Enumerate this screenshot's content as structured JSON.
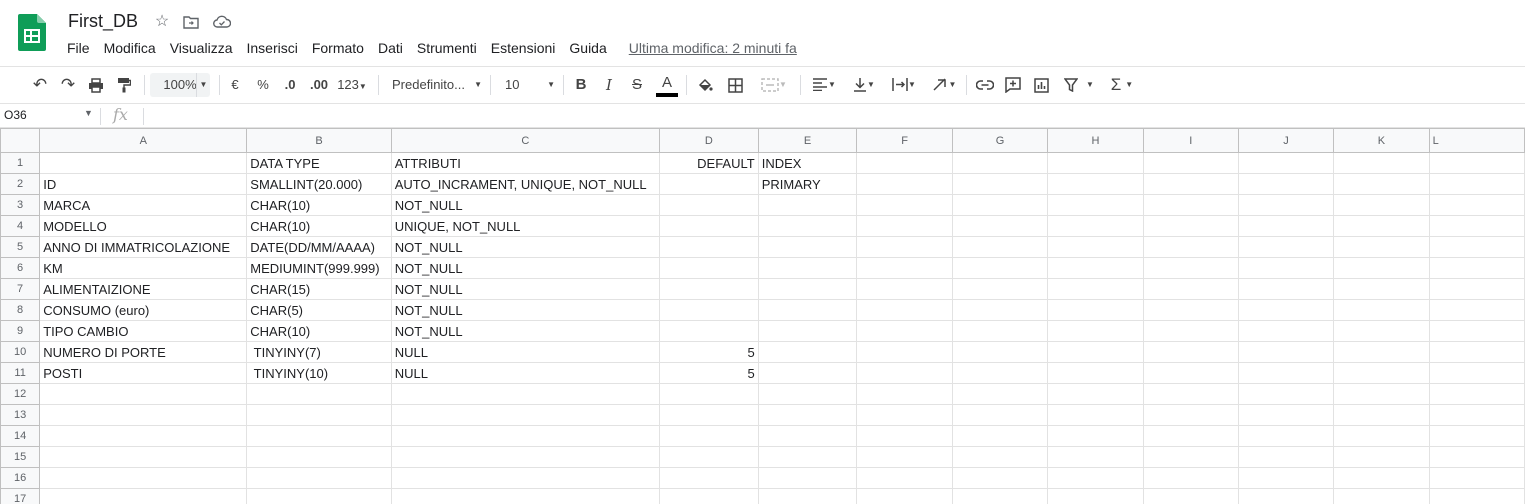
{
  "app": {
    "doc_title": "First_DB",
    "menu": [
      "File",
      "Modifica",
      "Visualizza",
      "Inserisci",
      "Formato",
      "Dati",
      "Strumenti",
      "Estensioni",
      "Guida"
    ],
    "last_edit": "Ultima modifica: 2 minuti fa",
    "brand_color": "#0f9d58"
  },
  "toolbar": {
    "zoom": "100%",
    "currency": "€",
    "percent": "%",
    "dec_decrease": ".0",
    "dec_increase": ".00",
    "number_format": "123",
    "font": "Predefinito...",
    "font_size": "10",
    "bold": "B",
    "italic": "I",
    "strike": "S",
    "text_color": "A"
  },
  "formula_bar": {
    "cell_ref": "O36",
    "fx": "fx",
    "value": ""
  },
  "sheet": {
    "columns": [
      "A",
      "B",
      "C",
      "D",
      "E",
      "F",
      "G",
      "H",
      "I",
      "J",
      "K",
      "L"
    ],
    "rows": [
      {
        "num": "1",
        "cells": [
          "",
          "DATA TYPE",
          "ATTRIBUTI",
          "DEFAULT",
          "INDEX"
        ]
      },
      {
        "num": "2",
        "cells": [
          "ID",
          "SMALLINT(20.000)",
          "AUTO_INCRAMENT, UNIQUE, NOT_NULL",
          "",
          "PRIMARY"
        ]
      },
      {
        "num": "3",
        "cells": [
          "MARCA",
          "CHAR(10)",
          "NOT_NULL",
          "",
          ""
        ]
      },
      {
        "num": "4",
        "cells": [
          "MODELLO",
          "CHAR(10)",
          "UNIQUE, NOT_NULL",
          "",
          ""
        ]
      },
      {
        "num": "5",
        "cells": [
          "ANNO DI IMMATRICOLAZIONE",
          "DATE(DD/MM/AAAA)",
          "NOT_NULL",
          "",
          ""
        ]
      },
      {
        "num": "6",
        "cells": [
          "KM",
          "MEDIUMINT(999.999)",
          "NOT_NULL",
          "",
          ""
        ]
      },
      {
        "num": "7",
        "cells": [
          "ALIMENTAIZIONE",
          "CHAR(15)",
          "NOT_NULL",
          "",
          ""
        ]
      },
      {
        "num": "8",
        "cells": [
          "CONSUMO (euro)",
          "CHAR(5)",
          "NOT_NULL",
          "",
          ""
        ]
      },
      {
        "num": "9",
        "cells": [
          "TIPO CAMBIO",
          "CHAR(10)",
          "NOT_NULL",
          "",
          ""
        ]
      },
      {
        "num": "10",
        "cells": [
          "NUMERO DI PORTE",
          " TINYINY(7)",
          "NULL",
          "5",
          ""
        ]
      },
      {
        "num": "11",
        "cells": [
          "POSTI",
          " TINYINY(10)",
          "NULL",
          "5",
          ""
        ]
      },
      {
        "num": "12",
        "cells": [
          "",
          "",
          "",
          "",
          ""
        ]
      },
      {
        "num": "13",
        "cells": [
          "",
          "",
          "",
          "",
          ""
        ]
      },
      {
        "num": "14",
        "cells": [
          "",
          "",
          "",
          "",
          ""
        ]
      },
      {
        "num": "15",
        "cells": [
          "",
          "",
          "",
          "",
          ""
        ]
      },
      {
        "num": "16",
        "cells": [
          "",
          "",
          "",
          "",
          ""
        ]
      },
      {
        "num": "17",
        "cells": [
          "",
          "",
          "",
          "",
          ""
        ]
      }
    ]
  }
}
